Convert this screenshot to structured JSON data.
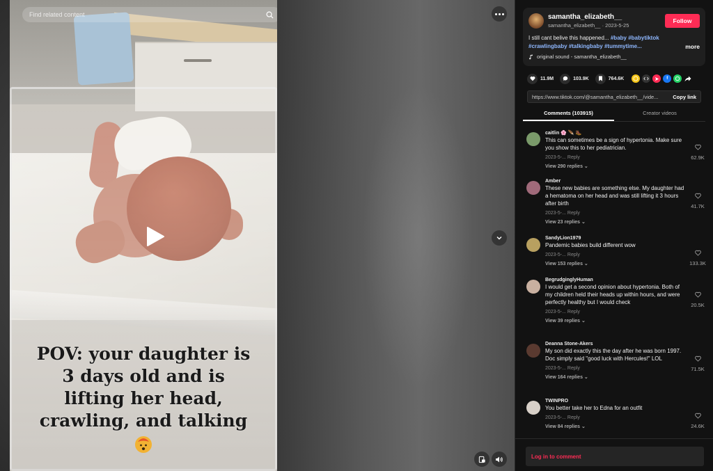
{
  "search": {
    "placeholder": "Find related content"
  },
  "video": {
    "caption": "POV: your daughter is 3 days old and is lifting her head, crawling, and talking",
    "caption_lines": [
      "POV: your daughter is",
      "3 days old and is",
      "lifting her head,",
      "crawling, and talking"
    ],
    "emoji_icon": "exploding-head-emoji"
  },
  "author": {
    "name": "samantha_elizabeth__",
    "handle": "samantha_elizabeth__",
    "date": "2023-5-25",
    "follow_label": "Follow",
    "description": "I still cant belive this happened...",
    "hashtags": [
      "#baby",
      "#babytiktok",
      "#crawlingbaby",
      "#talkingbaby",
      "#tummytime..."
    ],
    "more_label": "more",
    "sound": "original sound - samantha_elizabeth__"
  },
  "stats": {
    "likes": "11.9M",
    "comments": "103.9K",
    "saves": "764.6K"
  },
  "link": {
    "url": "https://www.tiktok.com/@samantha_elizabeth__/vide...",
    "copy_label": "Copy link"
  },
  "tabs": [
    {
      "label": "Comments (103915)",
      "active": true
    },
    {
      "label": "Creator videos",
      "active": false
    }
  ],
  "comments": [
    {
      "name": "caitlin 🌸 🪶 🥾",
      "text": "This can sometimes be a sign of hypertonia. Make sure you show this to her pediatrician.",
      "date": "2023-5-...",
      "reply": "Reply",
      "replies": "View 290 replies",
      "likes": "62.9K",
      "avatar_color": "#7a9a6a"
    },
    {
      "name": "Amber",
      "text": "These new babies are something else. My daughter had a hematoma on her head and was still lifting it 3 hours after birth",
      "date": "2023-5-...",
      "reply": "Reply",
      "replies": "View 23 replies",
      "likes": "41.7K",
      "avatar_color": "#a06a7a"
    },
    {
      "name": "SandyLion1979",
      "text": "Pandemic babies build different wow",
      "date": "2023-5-...",
      "reply": "Reply",
      "replies": "View 153 replies",
      "likes": "133.3K",
      "avatar_color": "#b8a060"
    },
    {
      "name": "BegrudginglyHuman",
      "text": "I would get a second opinion about hypertonia. Both of my children held their heads up within hours, and were perfectly healthy but I would check",
      "date": "2023-5-...",
      "reply": "Reply",
      "replies": "View 39 replies",
      "likes": "20.5K",
      "avatar_color": "#c9b0a0"
    },
    {
      "name": "Deanna Stone-Akers",
      "text": "My son did exactly this the day after he was born 1997. Doc simply said \"good luck with Hercules!\" LOL",
      "date": "2023-5-...",
      "reply": "Reply",
      "replies": "View 164 replies",
      "likes": "71.5K",
      "avatar_color": "#5a3a30"
    },
    {
      "name": "TWINPRO",
      "text": "You better take her to Edna for an outfit",
      "date": "2023-5-...",
      "reply": "Reply",
      "replies": "View 84 replies",
      "likes": "24.6K",
      "avatar_color": "#d8d0c8"
    }
  ],
  "login": {
    "label": "Log in to comment"
  },
  "colors": {
    "accent": "#fe2c55",
    "hashtag": "#8fb8ff",
    "panel_bg": "#121212"
  }
}
